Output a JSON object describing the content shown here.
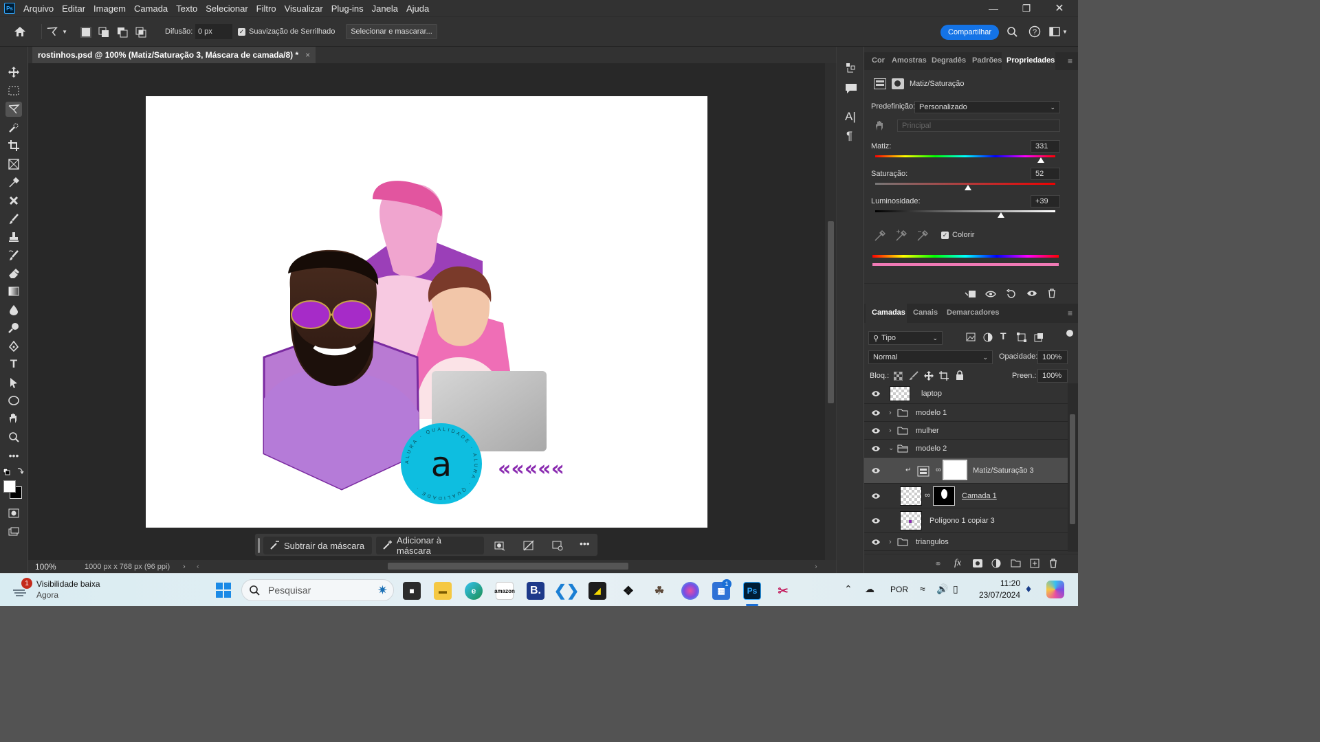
{
  "app": {
    "logo_text": "Ps",
    "menu": [
      "Arquivo",
      "Editar",
      "Imagem",
      "Camada",
      "Texto",
      "Selecionar",
      "Filtro",
      "Visualizar",
      "Plug-ins",
      "Janela",
      "Ajuda"
    ]
  },
  "options": {
    "feather_label": "Difusão:",
    "feather_value": "0 px",
    "antialias_label": "Suavização de Serrilhado",
    "select_mask_label": "Selecionar e mascarar...",
    "share_label": "Compartilhar"
  },
  "document": {
    "tab_title": "rostinhos.psd @ 100% (Matiz/Saturação 3, Máscara de camada/8) *",
    "zoom": "100%",
    "dimensions": "1000 px x 768 px (96 ppi)"
  },
  "contextbar": {
    "subtract_label": "Subtrair da máscara",
    "add_label": "Adicionar à máscara"
  },
  "canvas": {
    "badge_letter": "a",
    "badge_ring_text": "ALURA · QUALIDADE · ALURA · QUALIDADE ·",
    "chevrons": "«««««"
  },
  "properties": {
    "tabs": [
      "Cor",
      "Amostras",
      "Degradês",
      "Padrões",
      "Propriedades"
    ],
    "panel_title": "Matiz/Saturação",
    "preset_label": "Predefinição:",
    "preset_value": "Personalizado",
    "channel_value": "Principal",
    "hue": {
      "label": "Matiz:",
      "value": "331"
    },
    "saturation": {
      "label": "Saturação:",
      "value": "52"
    },
    "lightness": {
      "label": "Luminosidade:",
      "value": "+39"
    },
    "colorize_label": "Colorir"
  },
  "layers": {
    "tabs": [
      "Camadas",
      "Canais",
      "Demarcadores"
    ],
    "filter_label": "Tipo",
    "blend_mode": "Normal",
    "opacity_label": "Opacidade:",
    "opacity_value": "100%",
    "lock_label": "Bloq.:",
    "fill_label": "Preen.:",
    "fill_value": "100%",
    "items": [
      {
        "name": "laptop",
        "kind": "smart"
      },
      {
        "name": "modelo 1",
        "kind": "group"
      },
      {
        "name": "mulher",
        "kind": "group"
      },
      {
        "name": "modelo 2",
        "kind": "group-open"
      },
      {
        "name": "Matiz/Saturação 3",
        "kind": "adjustment",
        "selected": true
      },
      {
        "name": "Camada 1",
        "kind": "smart-masked"
      },
      {
        "name": "Polígono 1 copiar 3",
        "kind": "shape"
      },
      {
        "name": "triangulos",
        "kind": "group"
      }
    ]
  },
  "taskbar": {
    "notification_title": "Visibilidade baixa",
    "notification_sub": "Agora",
    "notification_count": "1",
    "search_placeholder": "Pesquisar",
    "store_badge": "1",
    "lang": "POR",
    "time": "11:20",
    "date": "23/07/2024"
  },
  "colors": {
    "accent_blue": "#1473e6",
    "ps_blue": "#31a8ff",
    "badge_cyan": "#0ebee0",
    "purple": "#9b3fb8",
    "pink": "#e85ab0"
  }
}
